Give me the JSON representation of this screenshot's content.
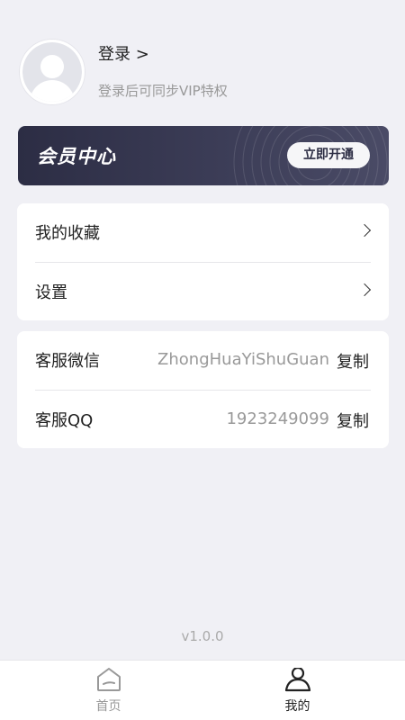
{
  "profile": {
    "login_title": "登录 >",
    "login_subtitle": "登录后可同步VIP特权"
  },
  "vip": {
    "title": "会员中心",
    "button_label": "立即开通"
  },
  "menu": {
    "items": [
      {
        "label": "我的收藏"
      },
      {
        "label": "设置"
      }
    ]
  },
  "service": {
    "rows": [
      {
        "label": "客服微信",
        "value": "ZhongHuaYiShuGuan",
        "action": "复制"
      },
      {
        "label": "客服QQ",
        "value": "1923249099",
        "action": "复制"
      }
    ]
  },
  "version": "v1.0.0",
  "tabbar": {
    "tabs": [
      {
        "label": "首页",
        "icon": "home-icon",
        "active": false
      },
      {
        "label": "我的",
        "icon": "user-icon",
        "active": true
      }
    ]
  },
  "colors": {
    "background": "#f0f0f5",
    "vip_card": "#2c2d44",
    "text_primary": "#222222",
    "text_secondary": "#999999"
  }
}
